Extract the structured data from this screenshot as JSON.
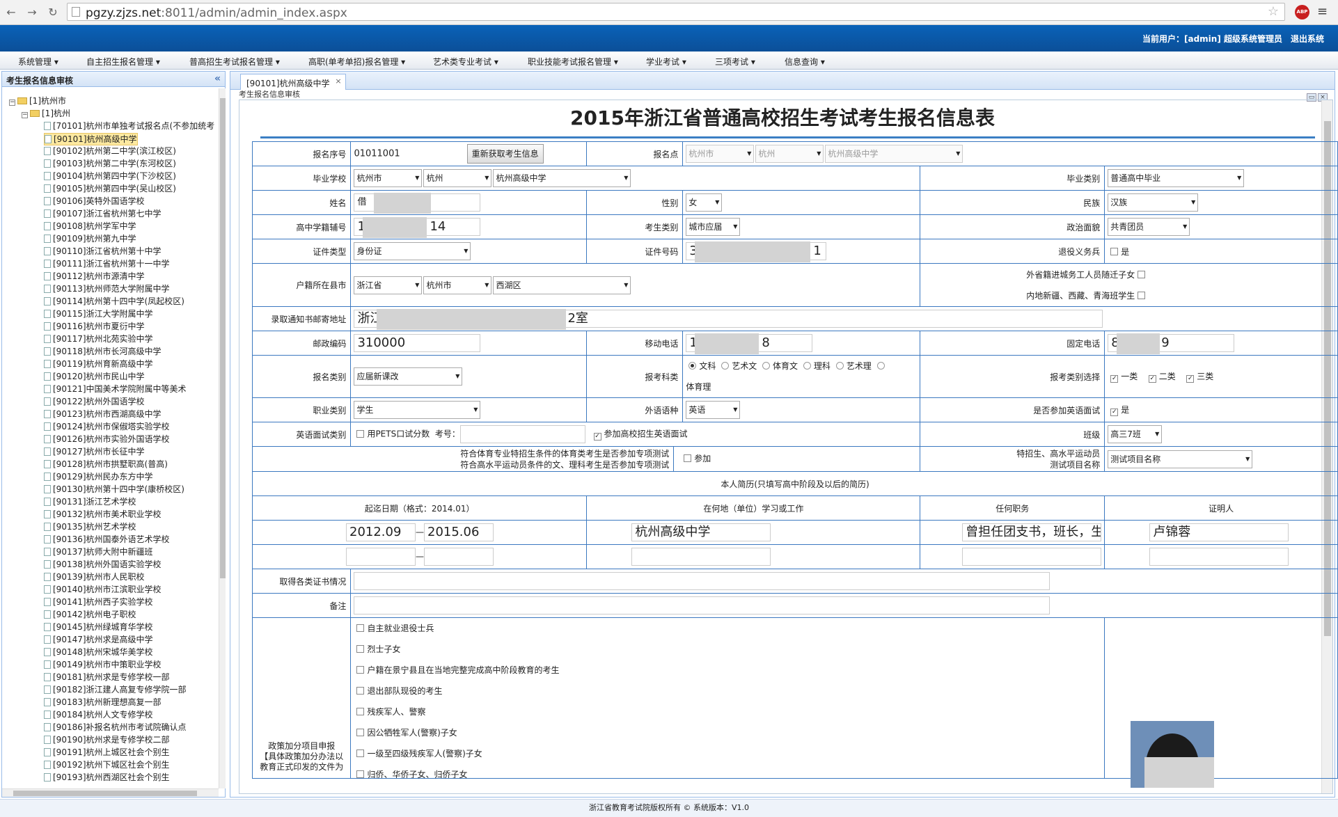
{
  "browser": {
    "url_host": "pgzy.zjzs.net",
    "url_rest": ":8011/admin/admin_index.aspx",
    "abp": "ABP"
  },
  "header": {
    "user_info": "当前用户：[admin] 超级系统管理员",
    "logout": "退出系统"
  },
  "menu": [
    "系统管理 ▾",
    "自主招生报名管理 ▾",
    "普高招生考试报名管理 ▾",
    "高职(单考单招)报名管理 ▾",
    "艺术类专业考试 ▾",
    "职业技能考试报名管理 ▾",
    "学业考试 ▾",
    "三项考试 ▾",
    "信息查询 ▾"
  ],
  "left_panel": {
    "title": "考生报名信息审核",
    "root": "[1]杭州市",
    "child": "[1]杭州",
    "items": [
      "[70101]杭州市单独考试报名点(不参加统考",
      "[90101]杭州高级中学",
      "[90102]杭州第二中学(滨江校区)",
      "[90103]杭州第二中学(东河校区)",
      "[90104]杭州第四中学(下沙校区)",
      "[90105]杭州第四中学(吴山校区)",
      "[90106]英特外国语学校",
      "[90107]浙江省杭州第七中学",
      "[90108]杭州学军中学",
      "[90109]杭州第九中学",
      "[90110]浙江省杭州第十中学",
      "[90111]浙江省杭州第十一中学",
      "[90112]杭州市源清中学",
      "[90113]杭州师范大学附属中学",
      "[90114]杭州第十四中学(凤起校区)",
      "[90115]浙江大学附属中学",
      "[90116]杭州市夏衍中学",
      "[90117]杭州北苑实验中学",
      "[90118]杭州市长河高级中学",
      "[90119]杭州育新高级中学",
      "[90120]杭州市民山中学",
      "[90121]中国美术学院附属中等美术",
      "[90122]杭州外国语学校",
      "[90123]杭州市西湖高级中学",
      "[90124]杭州市保俶塔实验学校",
      "[90126]杭州市实验外国语学校",
      "[90127]杭州市长征中学",
      "[90128]杭州市拱墅职高(普高)",
      "[90129]杭州民办东方中学",
      "[90130]杭州第十四中学(康桥校区)",
      "[90131]浙江艺术学校",
      "[90132]杭州市美术职业学校",
      "[90135]杭州艺术学校",
      "[90136]杭州国泰外语艺术学校",
      "[90137]杭师大附中新疆班",
      "[90138]杭州外国语实验学校",
      "[90139]杭州市人民职校",
      "[90140]杭州市江滨职业学校",
      "[90141]杭州西子实验学校",
      "[90142]杭州电子职校",
      "[90145]杭州绿城育华学校",
      "[90147]杭州求是高级中学",
      "[90148]杭州宋城华美学校",
      "[90149]杭州市中策职业学校",
      "[90181]杭州求是专修学校一部",
      "[90182]浙江建人高复专修学院一部",
      "[90183]杭州新理想高复一部",
      "[90184]杭州人文专修学校",
      "[90186]补报名杭州市考试院确认点",
      "[90190]杭州求是专修学校二部",
      "[90191]杭州上城区社会个别生",
      "[90192]杭州下城区社会个别生",
      "[90193]杭州西湖区社会个别生"
    ]
  },
  "tab": {
    "label": "[90101]杭州高级中学",
    "close": "×",
    "sub_title": "考生报名信息审核"
  },
  "form": {
    "title": "2015年浙江省普通高校招生考试考生报名信息表",
    "l_seq": "报名序号",
    "v_seq": "01011001",
    "btn_refresh": "重新获取考生信息",
    "l_point": "报名点",
    "v_point": [
      "杭州市",
      "杭州",
      "杭州高级中学"
    ],
    "l_school": "毕业学校",
    "v_school": [
      "杭州市",
      "杭州",
      "杭州高级中学"
    ],
    "l_gradtype": "毕业类别",
    "v_gradtype": "普通高中毕业",
    "l_name": "姓名",
    "v_name": "借",
    "l_gender": "性别",
    "v_gender": "女",
    "l_ethnic": "民族",
    "v_ethnic": "汉族",
    "l_stuno": "高中学籍辅号",
    "v_stuno_a": "1",
    "v_stuno_b": "14",
    "l_stutype": "考生类别",
    "v_stutype": "城市应届",
    "l_political": "政治面貌",
    "v_political": "共青团员",
    "l_idtype": "证件类型",
    "v_idtype": "身份证",
    "l_idno": "证件号码",
    "v_idno_a": "3",
    "v_idno_b": "1",
    "l_veteran": "退役义务兵",
    "v_veteran": "是",
    "l_hukou": "户籍所在县市",
    "v_hukou": [
      "浙江省",
      "杭州市",
      "西湖区"
    ],
    "l_migrant": "外省籍进城务工人员随迁子女",
    "l_xinjiang": "内地新疆、西藏、青海班学生",
    "l_address": "录取通知书邮寄地址",
    "v_address_a": "浙江",
    "v_address_b": "2室",
    "l_zip": "邮政编码",
    "v_zip": "310000",
    "l_mobile": "移动电话",
    "v_mobile_a": "1",
    "v_mobile_b": "8",
    "l_phone": "固定电话",
    "v_phone_a": "8",
    "v_phone_b": "9",
    "l_regtype": "报名类别",
    "v_regtype": "应届新课改",
    "l_subject": "报考科类",
    "subjects": [
      "文科",
      "艺术文",
      "体育文",
      "理科",
      "艺术理",
      "体育理"
    ],
    "l_choice": "报考类别选择",
    "choices": [
      "一类",
      "二类",
      "三类"
    ],
    "l_job": "职业类别",
    "v_job": "学生",
    "l_lang": "外语语种",
    "v_lang": "英语",
    "l_oral": "是否参加英语面试",
    "v_oral": "是",
    "l_oraltype": "英语面试类别",
    "v_pets": "用PETS口试分数",
    "l_examno": "考号：",
    "v_oral_college": "参加高校招生英语面试",
    "l_class": "班级",
    "v_class": "高三7班",
    "l_sports_q1": "符合体育专业特招生条件的体育类考生是否参加专项测试",
    "l_sports_q2": "符合高水平运动员条件的文、理科考生是否参加专项测试",
    "v_sports": "参加",
    "l_sports_item_1": "特招生、高水平运动员",
    "l_sports_item_2": "测试项目名称",
    "v_sports_item": "测试项目名称",
    "resume_title": "本人简历(只填写高中阶段及以后的简历)",
    "h_date": "起迄日期（格式：2014.01）",
    "h_place": "在何地（单位）学习或工作",
    "h_duty": "任何职务",
    "h_witness": "证明人",
    "r1_start": "2012.09",
    "r1_dash": "—",
    "r1_end": "2015.06",
    "r1_place": "杭州高级中学",
    "r1_duty": "曾担任团支书，班长，生",
    "r1_witness": "卢锦蓉",
    "r2_dash": "—",
    "l_cert": "取得各类证书情况",
    "l_remark": "备注",
    "l_policy_1": "政策加分项目申报",
    "l_policy_2": "【具体政策加分办法以",
    "l_policy_3": "教育正式印发的文件为",
    "policies": [
      "自主就业退役士兵",
      "烈士子女",
      "户籍在景宁县且在当地完整完成高中阶段教育的考生",
      "退出部队现役的考生",
      "残疾军人、警察",
      "因公牺牲军人(警察)子女",
      "一级至四级残疾军人(警察)子女",
      "归侨、华侨子女、归侨子女"
    ]
  },
  "footer": "浙江省教育考试院版权所有 ©    系统版本：V1.0"
}
